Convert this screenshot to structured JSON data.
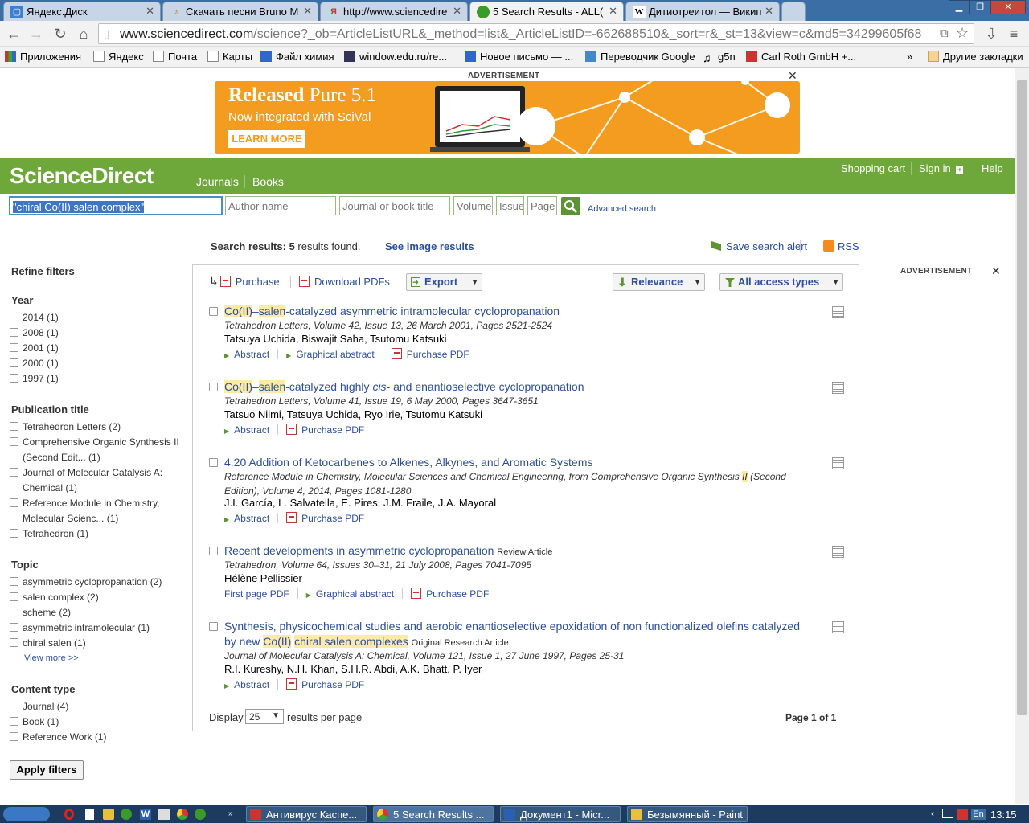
{
  "browser": {
    "tabs": [
      {
        "title": "Яндекс.Диск",
        "icon": "yandex-disk-icon",
        "color": "#3f7fd2"
      },
      {
        "title": "Скачать песни Bruno M",
        "icon": "music-icon",
        "color": "#d8a040"
      },
      {
        "title": "http://www.sciencedire",
        "icon": "yandex-icon",
        "color": "#cc3333"
      },
      {
        "title": "5 Search Results - ALL(",
        "icon": "green-circle-icon",
        "color": "#3a9a2a"
      },
      {
        "title": "Дитиотреитол — Викип",
        "icon": "wikipedia-icon",
        "color": "#444444"
      }
    ],
    "url_host": "www.sciencedirect.com",
    "url_rest": "/science?_ob=ArticleListURL&_method=list&_ArticleListID=-662688510&_sort=r&_st=13&view=c&md5=34299605f68",
    "bookmarks": [
      "Приложения",
      "Яндекс",
      "Почта",
      "Карты",
      "Файл химия",
      "window.edu.ru/re...",
      "Новое письмо — ...",
      "Переводчик Google",
      "g5n",
      "Carl Roth GmbH +..."
    ],
    "bookmarks_more": "»",
    "other_bookmarks": "Другие закладки"
  },
  "ad": {
    "label": "ADVERTISEMENT",
    "close": "✕",
    "headline_bold": "Released",
    "headline_rest": "Pure 5.1",
    "subline": "Now integrated with SciVal",
    "cta": "LEARN MORE"
  },
  "header": {
    "logo": "ScienceDirect",
    "nav": [
      "Journals",
      "Books"
    ],
    "right": [
      "Shopping cart",
      "Sign in",
      "Help"
    ]
  },
  "search": {
    "query": "\"chiral Co(II) salen complex\"",
    "author_placeholder": "Author name",
    "journal_placeholder": "Journal or book title",
    "volume_placeholder": "Volume",
    "issue_placeholder": "Issue",
    "page_placeholder": "Page",
    "advanced": "Advanced search"
  },
  "results_header": {
    "label": "Search results:",
    "count": "5",
    "suffix": "results found.",
    "image_link": "See image results",
    "save_alert": "Save search alert",
    "rss": "RSS",
    "right_ad_label": "ADVERTISEMENT",
    "right_ad_close": "✕"
  },
  "toolbar": {
    "purchase": "Purchase",
    "download": "Download PDFs",
    "export": "Export",
    "relevance": "Relevance",
    "access": "All access types"
  },
  "filters": {
    "title": "Refine filters",
    "year_h": "Year",
    "years": [
      "2014  (1)",
      "2008  (1)",
      "2001  (1)",
      "2000  (1)",
      "1997  (1)"
    ],
    "pub_h": "Publication title",
    "pubs": [
      "Tetrahedron Letters  (2)",
      "Comprehensive Organic Synthesis II",
      "(Second Edit...  (1)",
      "Journal of Molecular Catalysis A:",
      "Chemical  (1)",
      "Reference Module in Chemistry,",
      "Molecular Scienc...  (1)",
      "Tetrahedron  (1)"
    ],
    "topic_h": "Topic",
    "topics": [
      "asymmetric cyclopropanation  (2)",
      "salen complex  (2)",
      "scheme  (2)",
      "asymmetric intramolecular  (1)",
      "chiral salen  (1)"
    ],
    "view_more": "View more >>",
    "content_h": "Content type",
    "contents": [
      "Journal  (4)",
      "Book  (1)",
      "Reference Work  (1)"
    ],
    "apply": "Apply filters"
  },
  "results": [
    {
      "t1": "Co(II)",
      "t2": "–",
      "t3": "salen",
      "t4": "-catalyzed asymmetric intramolecular cyclopropanation",
      "journal": "Tetrahedron Letters, Volume 42, Issue 13, 26 March 2001, Pages 2521-2524",
      "authors": "Tatsuya Uchida, Biswajit Saha, Tsutomu Katsuki",
      "links": [
        "Abstract",
        "Graphical abstract",
        "Purchase PDF"
      ]
    },
    {
      "t1": "Co(II)",
      "t2": "–",
      "t3": "salen",
      "t4": "-catalyzed highly ",
      "t4i": "cis",
      "t5": "- and enantioselective cyclopropanation",
      "journal": "Tetrahedron Letters, Volume 41, Issue 19, 6 May 2000, Pages 3647-3651",
      "authors": "Tatsuo Niimi, Tatsuya Uchida, Ryo Irie, Tsutomu Katsuki",
      "links": [
        "Abstract",
        "Purchase PDF"
      ]
    },
    {
      "title": "4.20 Addition of Ketocarbenes to Alkenes, Alkynes, and Aromatic Systems",
      "journal1": "Reference Module in Chemistry, Molecular Sciences and Chemical Engineering, from Comprehensive Organic Synthesis ",
      "journal_hl": "II",
      "journal2": " (Second Edition), Volume 4, 2014, Pages 1081-1280",
      "authors": "J.I. García, L. Salvatella, E. Pires, J.M. Fraile, J.A. Mayoral",
      "links": [
        "Abstract",
        "Purchase PDF"
      ]
    },
    {
      "title": "Recent developments in asymmetric cyclopropanation",
      "type": "Review Article",
      "journal": "Tetrahedron, Volume 64, Issues 30–31, 21 July 2008, Pages 7041-7095",
      "authors": "Hélène Pellissier",
      "links": [
        "First page PDF",
        "Graphical abstract",
        "Purchase PDF"
      ]
    },
    {
      "t1": "Synthesis, physicochemical studies and aerobic enantioselective epoxidation of non functionalized olefins catalyzed by new ",
      "t2": "Co(II)",
      "t3": " ",
      "t4": "chiral salen complexes",
      "type": "Original Research Article",
      "journal": "Journal of Molecular Catalysis A: Chemical, Volume 121, Issue 1, 27 June 1997, Pages 25-31",
      "authors": "R.I. Kureshy, N.H. Khan, S.H.R. Abdi, A.K. Bhatt, P. Iyer",
      "links": [
        "Abstract",
        "Purchase PDF"
      ]
    }
  ],
  "footer": {
    "display": "Display",
    "per_page": "25",
    "per_page_suffix": "results per page",
    "page_of": "Page 1 of 1"
  },
  "taskbar": {
    "items": [
      "Антивирус Каспе...",
      "5 Search Results ...",
      "Документ1 - Micr...",
      "Безымянный - Paint"
    ],
    "lang": "En",
    "time": "13:15"
  },
  "colors": {
    "brand_green": "#6ea73a",
    "link_blue": "#2d4f9e",
    "highlight": "#fbeba6",
    "ad_orange": "#f39c1f"
  }
}
